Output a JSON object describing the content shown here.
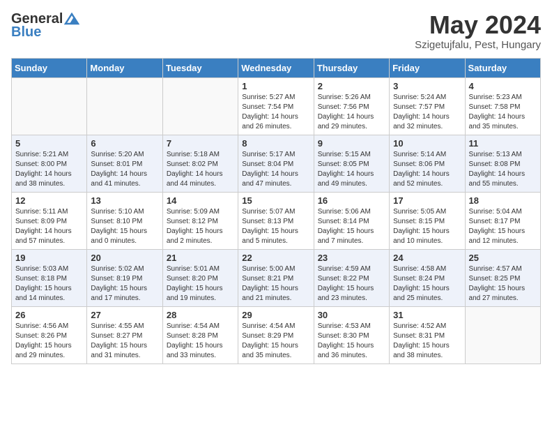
{
  "logo": {
    "line1": "General",
    "line2": "Blue"
  },
  "title": "May 2024",
  "subtitle": "Szigetujfalu, Pest, Hungary",
  "weekdays": [
    "Sunday",
    "Monday",
    "Tuesday",
    "Wednesday",
    "Thursday",
    "Friday",
    "Saturday"
  ],
  "weeks": [
    [
      null,
      null,
      null,
      {
        "day": "1",
        "sunrise": "5:27 AM",
        "sunset": "7:54 PM",
        "daylight": "14 hours and 26 minutes."
      },
      {
        "day": "2",
        "sunrise": "5:26 AM",
        "sunset": "7:56 PM",
        "daylight": "14 hours and 29 minutes."
      },
      {
        "day": "3",
        "sunrise": "5:24 AM",
        "sunset": "7:57 PM",
        "daylight": "14 hours and 32 minutes."
      },
      {
        "day": "4",
        "sunrise": "5:23 AM",
        "sunset": "7:58 PM",
        "daylight": "14 hours and 35 minutes."
      }
    ],
    [
      {
        "day": "5",
        "sunrise": "5:21 AM",
        "sunset": "8:00 PM",
        "daylight": "14 hours and 38 minutes."
      },
      {
        "day": "6",
        "sunrise": "5:20 AM",
        "sunset": "8:01 PM",
        "daylight": "14 hours and 41 minutes."
      },
      {
        "day": "7",
        "sunrise": "5:18 AM",
        "sunset": "8:02 PM",
        "daylight": "14 hours and 44 minutes."
      },
      {
        "day": "8",
        "sunrise": "5:17 AM",
        "sunset": "8:04 PM",
        "daylight": "14 hours and 47 minutes."
      },
      {
        "day": "9",
        "sunrise": "5:15 AM",
        "sunset": "8:05 PM",
        "daylight": "14 hours and 49 minutes."
      },
      {
        "day": "10",
        "sunrise": "5:14 AM",
        "sunset": "8:06 PM",
        "daylight": "14 hours and 52 minutes."
      },
      {
        "day": "11",
        "sunrise": "5:13 AM",
        "sunset": "8:08 PM",
        "daylight": "14 hours and 55 minutes."
      }
    ],
    [
      {
        "day": "12",
        "sunrise": "5:11 AM",
        "sunset": "8:09 PM",
        "daylight": "14 hours and 57 minutes."
      },
      {
        "day": "13",
        "sunrise": "5:10 AM",
        "sunset": "8:10 PM",
        "daylight": "15 hours and 0 minutes."
      },
      {
        "day": "14",
        "sunrise": "5:09 AM",
        "sunset": "8:12 PM",
        "daylight": "15 hours and 2 minutes."
      },
      {
        "day": "15",
        "sunrise": "5:07 AM",
        "sunset": "8:13 PM",
        "daylight": "15 hours and 5 minutes."
      },
      {
        "day": "16",
        "sunrise": "5:06 AM",
        "sunset": "8:14 PM",
        "daylight": "15 hours and 7 minutes."
      },
      {
        "day": "17",
        "sunrise": "5:05 AM",
        "sunset": "8:15 PM",
        "daylight": "15 hours and 10 minutes."
      },
      {
        "day": "18",
        "sunrise": "5:04 AM",
        "sunset": "8:17 PM",
        "daylight": "15 hours and 12 minutes."
      }
    ],
    [
      {
        "day": "19",
        "sunrise": "5:03 AM",
        "sunset": "8:18 PM",
        "daylight": "15 hours and 14 minutes."
      },
      {
        "day": "20",
        "sunrise": "5:02 AM",
        "sunset": "8:19 PM",
        "daylight": "15 hours and 17 minutes."
      },
      {
        "day": "21",
        "sunrise": "5:01 AM",
        "sunset": "8:20 PM",
        "daylight": "15 hours and 19 minutes."
      },
      {
        "day": "22",
        "sunrise": "5:00 AM",
        "sunset": "8:21 PM",
        "daylight": "15 hours and 21 minutes."
      },
      {
        "day": "23",
        "sunrise": "4:59 AM",
        "sunset": "8:22 PM",
        "daylight": "15 hours and 23 minutes."
      },
      {
        "day": "24",
        "sunrise": "4:58 AM",
        "sunset": "8:24 PM",
        "daylight": "15 hours and 25 minutes."
      },
      {
        "day": "25",
        "sunrise": "4:57 AM",
        "sunset": "8:25 PM",
        "daylight": "15 hours and 27 minutes."
      }
    ],
    [
      {
        "day": "26",
        "sunrise": "4:56 AM",
        "sunset": "8:26 PM",
        "daylight": "15 hours and 29 minutes."
      },
      {
        "day": "27",
        "sunrise": "4:55 AM",
        "sunset": "8:27 PM",
        "daylight": "15 hours and 31 minutes."
      },
      {
        "day": "28",
        "sunrise": "4:54 AM",
        "sunset": "8:28 PM",
        "daylight": "15 hours and 33 minutes."
      },
      {
        "day": "29",
        "sunrise": "4:54 AM",
        "sunset": "8:29 PM",
        "daylight": "15 hours and 35 minutes."
      },
      {
        "day": "30",
        "sunrise": "4:53 AM",
        "sunset": "8:30 PM",
        "daylight": "15 hours and 36 minutes."
      },
      {
        "day": "31",
        "sunrise": "4:52 AM",
        "sunset": "8:31 PM",
        "daylight": "15 hours and 38 minutes."
      },
      null
    ]
  ]
}
